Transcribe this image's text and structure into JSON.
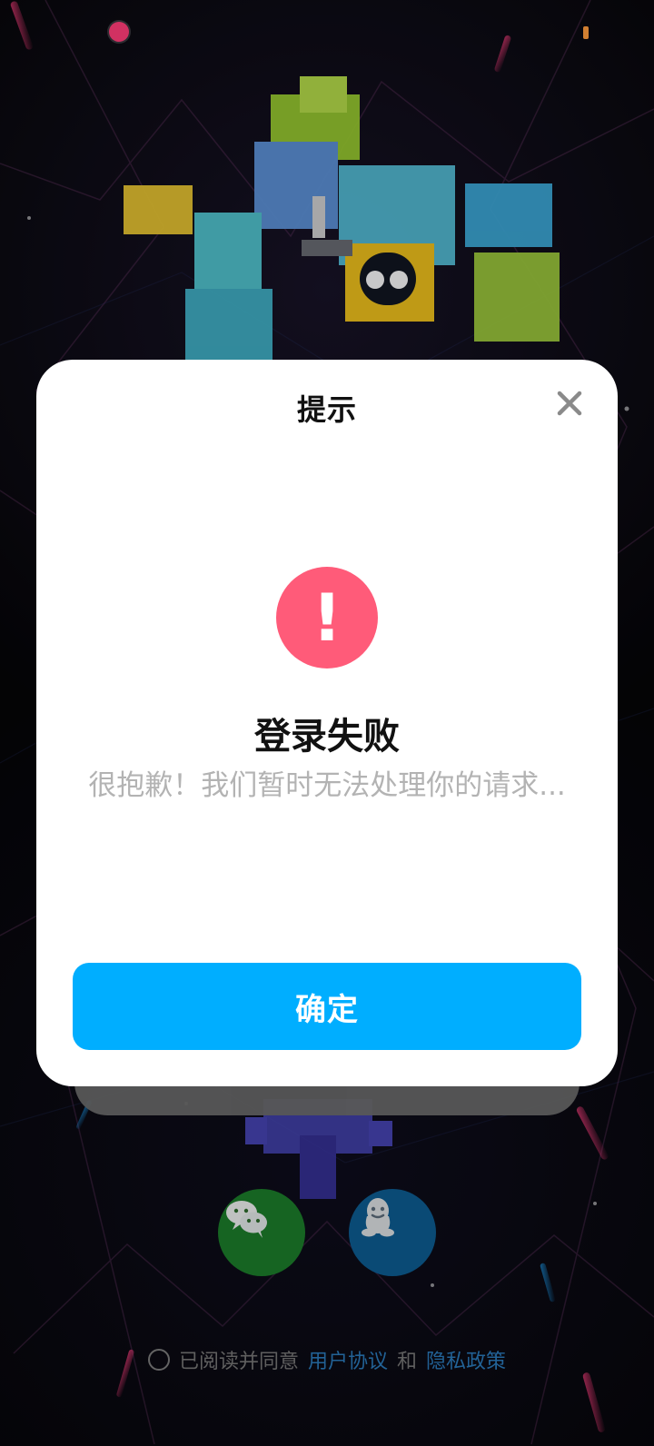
{
  "dialog": {
    "title": "提示",
    "heading": "登录失败",
    "message": "很抱歉！我们暂时无法处理你的请求...",
    "confirm_label": "确定",
    "alert_mark": "!"
  },
  "agreement": {
    "prefix": "已阅读并同意",
    "user_agreement": "用户协议",
    "and": "和",
    "privacy_policy": "隐私政策"
  },
  "icons": {
    "close": "close-icon",
    "wechat": "wechat-icon",
    "qq": "qq-icon",
    "alert": "alert-icon"
  },
  "colors": {
    "accent": "#00aeff",
    "alert": "#ff5b79",
    "link": "#2a78b8"
  }
}
